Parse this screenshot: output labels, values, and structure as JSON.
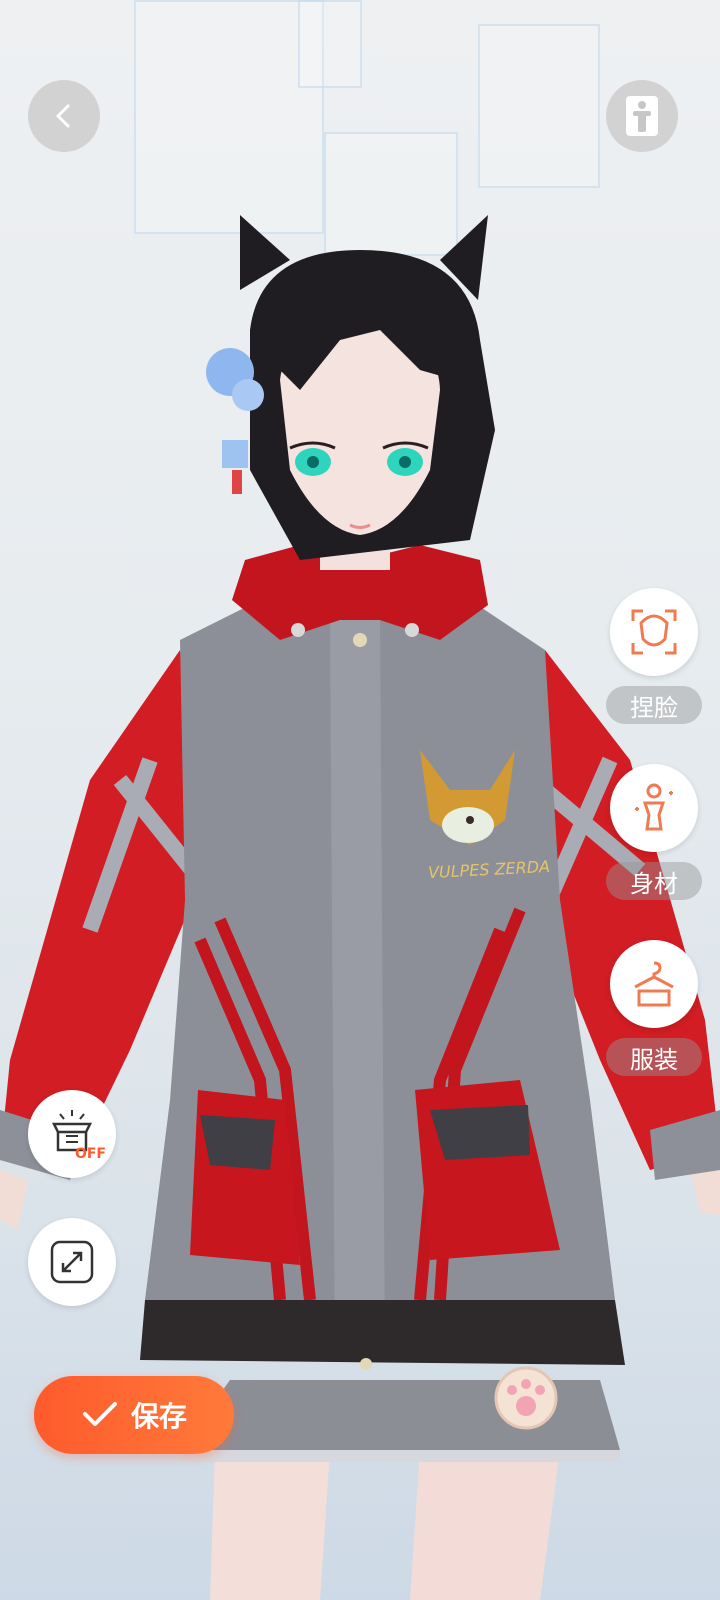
{
  "colors": {
    "accent": "#FF5A2C",
    "icon_orange": "#F07B52",
    "label_bg": "rgba(150,150,150,0.45)"
  },
  "top_bar": {
    "back_icon": "chevron-left-icon",
    "pose_icon": "person-stand-icon"
  },
  "side_menu": [
    {
      "label": "捏脸",
      "icon": "face-scan-icon"
    },
    {
      "label": "身材",
      "icon": "body-shape-icon"
    },
    {
      "label": "服装",
      "icon": "clothes-hanger-icon"
    }
  ],
  "left_tools": {
    "off_badge": "OFF",
    "lighting_icon": "lamp-off-icon",
    "expand_icon": "expand-icon"
  },
  "avatar": {
    "jacket_text": "VULPES ZERDA"
  },
  "save_button": {
    "label": "保存",
    "icon": "check-icon"
  }
}
